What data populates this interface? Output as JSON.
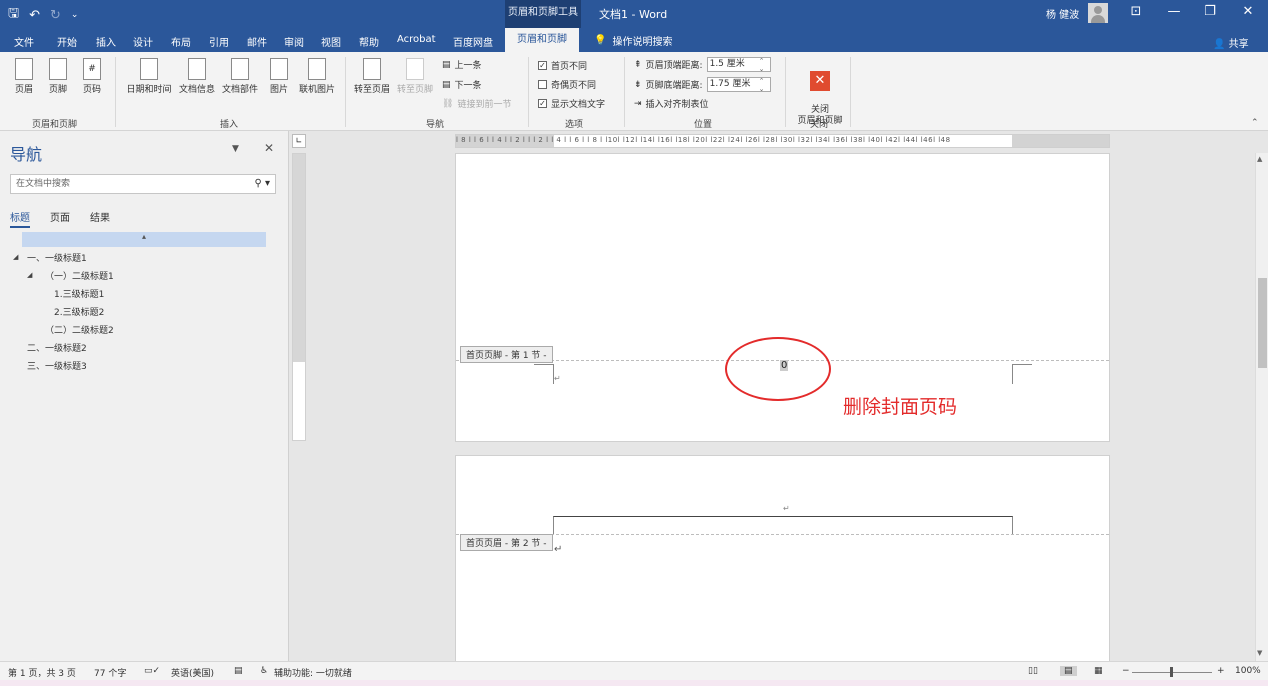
{
  "titlebar": {
    "context_tool": "页眉和页脚工具",
    "doc_title": "文档1  -  Word",
    "user": "杨 健波",
    "minimize": "—",
    "restore": "❐",
    "close": "✕",
    "ribbon_display": "⊡"
  },
  "tabs": [
    {
      "label": "文件"
    },
    {
      "label": "开始"
    },
    {
      "label": "插入"
    },
    {
      "label": "设计"
    },
    {
      "label": "布局"
    },
    {
      "label": "引用"
    },
    {
      "label": "邮件"
    },
    {
      "label": "审阅"
    },
    {
      "label": "视图"
    },
    {
      "label": "帮助"
    },
    {
      "label": "Acrobat"
    },
    {
      "label": "百度网盘"
    },
    {
      "label": "页眉和页脚"
    }
  ],
  "tellme": "操作说明搜索",
  "share": "共享",
  "ribbon": {
    "hf_group": {
      "label": "页眉和页脚",
      "header": "页眉",
      "footer": "页脚",
      "pagenum": "页码"
    },
    "insert_group": {
      "label": "插入",
      "datetime": "日期和时间",
      "docinfo": "文档信息",
      "docparts": "文档部件",
      "picture": "图片",
      "online_picture": "联机图片"
    },
    "nav_group": {
      "label": "导航",
      "goto_header": "转至页眉",
      "goto_footer": "转至页脚",
      "previous": "上一条",
      "next": "下一条",
      "link_prev": "链接到前一节"
    },
    "options_group": {
      "label": "选项",
      "diff_first": "首页不同",
      "diff_odd_even": "奇偶页不同",
      "show_text": "显示文档文字"
    },
    "position_group": {
      "label": "位置",
      "header_top_label": "页眉顶端距离:",
      "header_top_value": "1.5 厘米",
      "footer_bottom_label": "页脚底端距离:",
      "footer_bottom_value": "1.75 厘米",
      "insert_align_tab": "插入对齐制表位"
    },
    "close_group": {
      "label": "关闭",
      "close_hf": "关闭\n页眉和页脚"
    }
  },
  "nav": {
    "title": "导航",
    "search_placeholder": "在文档中搜索",
    "tabs": [
      "标题",
      "页面",
      "结果"
    ],
    "items": [
      {
        "text": "一、一级标题1"
      },
      {
        "text": "（一）二级标题1"
      },
      {
        "text": "1.三级标题1"
      },
      {
        "text": "2.三级标题2"
      },
      {
        "text": "（二）二级标题2"
      },
      {
        "text": "二、一级标题2"
      },
      {
        "text": "三、一级标题3"
      }
    ]
  },
  "ruler": {
    "h_numbers": "l 8 l  l 6 l  l 4 l  l 2 l     l   l 2 l   l 4 l   l 6 l   l 8 l   l10l   l12l   l14l   l16l   l18l   l20l   l22l   l24l   l26l   l28l   l30l   l32l   l34l   l36l   l38l   l40l   l42l   l44l   l46l   l48"
  },
  "document": {
    "page1_footer_tag": "首页页脚 - 第 1 节 -",
    "page_number": "0",
    "page2_header_tag": "首页页眉 - 第 2 节 -",
    "annotation": "删除封面页码"
  },
  "status": {
    "page": "第 1 页，共 3 页",
    "words": "77 个字",
    "language": "英语(美国)",
    "accessibility": "辅助功能: 一切就绪",
    "zoom": "100%"
  },
  "colors": {
    "title_blue": "#2b579a",
    "annotation_red": "#e32b2b"
  }
}
